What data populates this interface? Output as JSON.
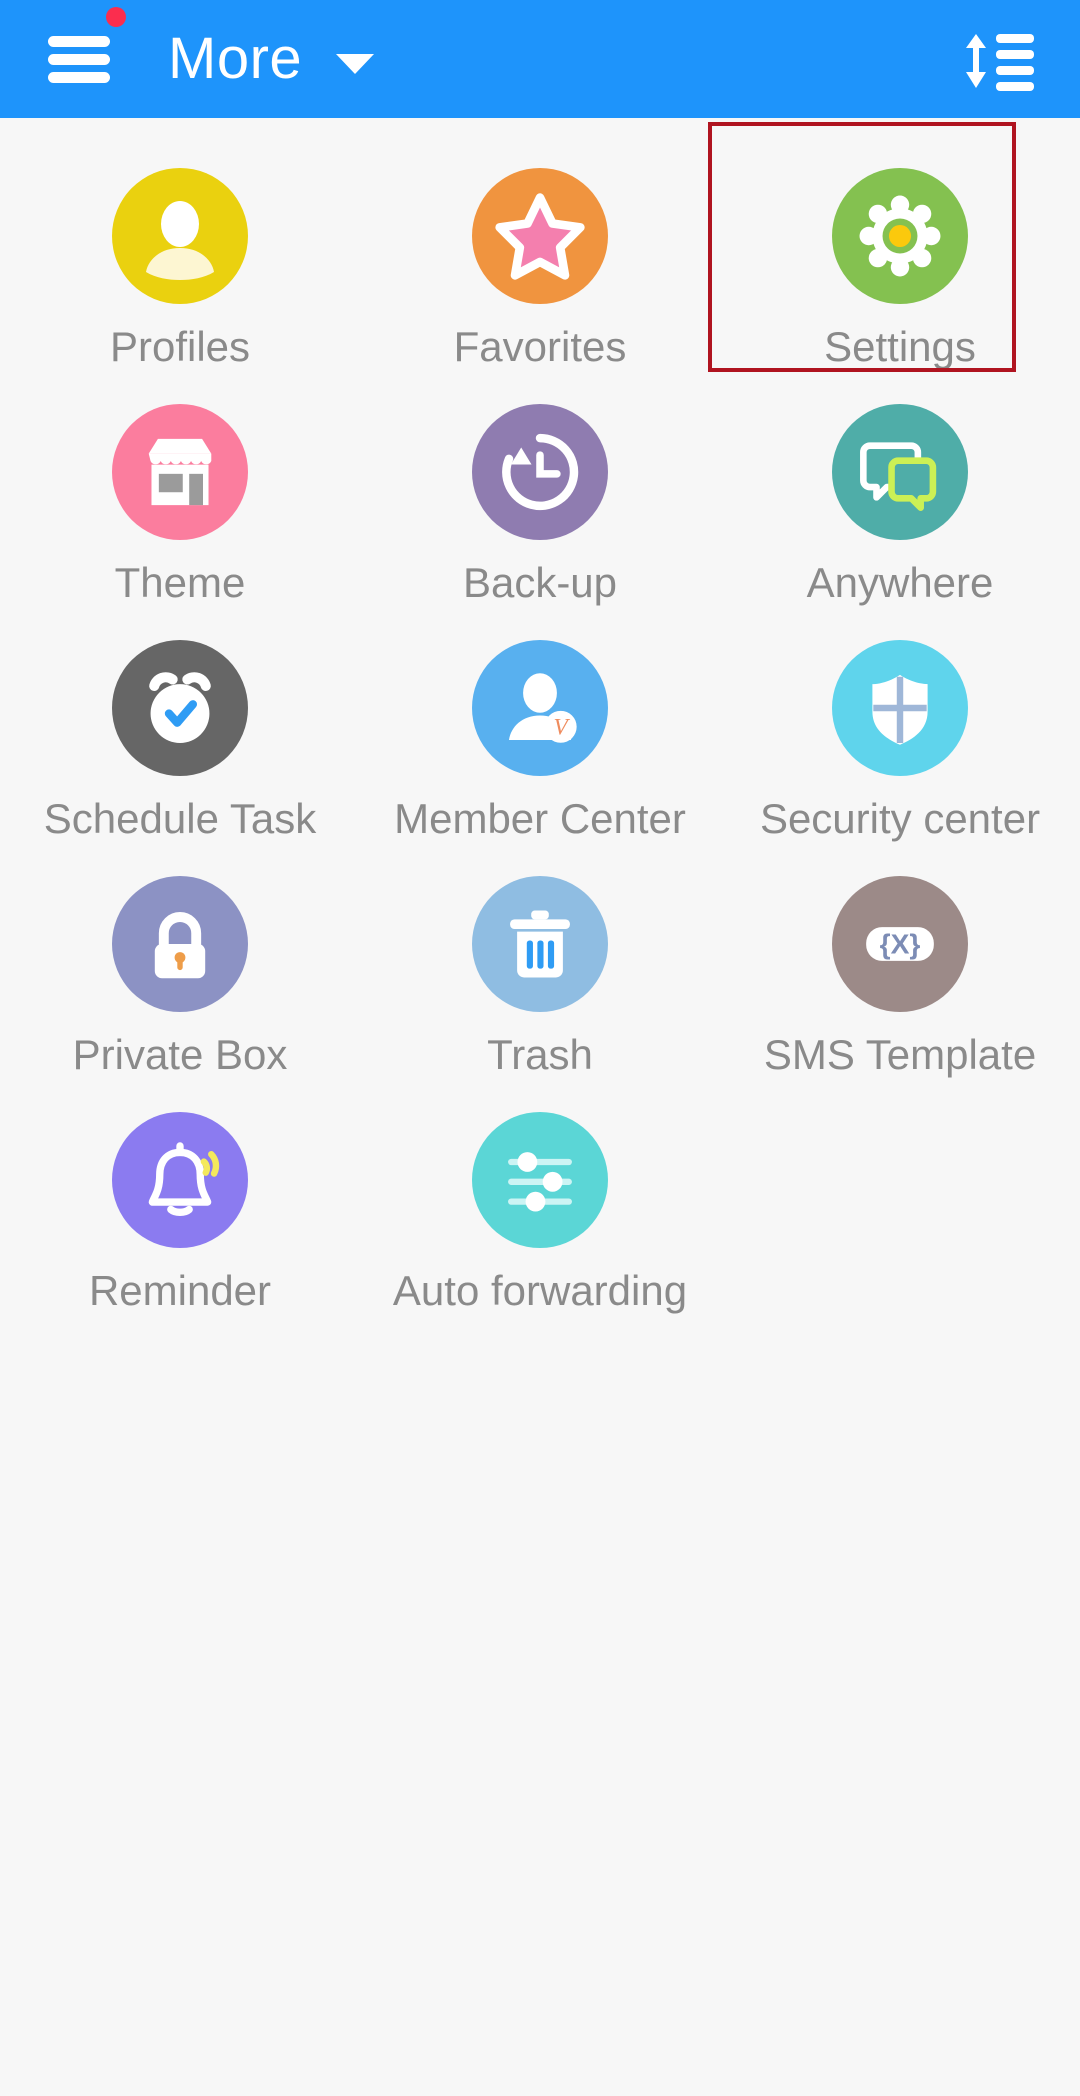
{
  "header": {
    "title": "More",
    "menu_icon": "hamburger-menu-icon",
    "badge": "notification-dot",
    "dropdown_icon": "chevron-down-icon",
    "sort_icon": "sort-list-icon",
    "background_color": "#1e94fb"
  },
  "highlight": {
    "target": "Settings",
    "color": "#b01420"
  },
  "grid": {
    "label_color": "#8a8a8a",
    "items": [
      {
        "label": "Profiles",
        "icon": "profile-person-icon",
        "circle_color": "#ead10f"
      },
      {
        "label": "Favorites",
        "icon": "star-icon",
        "circle_color": "#f0943f"
      },
      {
        "label": "Settings",
        "icon": "gear-icon",
        "circle_color": "#84c150"
      },
      {
        "label": "Theme",
        "icon": "storefront-icon",
        "circle_color": "#fb7d9e"
      },
      {
        "label": "Back-up",
        "icon": "clock-restore-icon",
        "circle_color": "#8f7cb0"
      },
      {
        "label": "Anywhere",
        "icon": "chat-bubbles-icon",
        "circle_color": "#4fada8"
      },
      {
        "label": "Schedule Task",
        "icon": "alarm-clock-check-icon",
        "circle_color": "#666666"
      },
      {
        "label": "Member Center",
        "icon": "member-vip-icon",
        "circle_color": "#58b0ef"
      },
      {
        "label": "Security center",
        "icon": "shield-icon",
        "circle_color": "#5fd4ec"
      },
      {
        "label": "Private Box",
        "icon": "padlock-icon",
        "circle_color": "#8c92c4"
      },
      {
        "label": "Trash",
        "icon": "trash-can-icon",
        "circle_color": "#8fbde2"
      },
      {
        "label": "SMS Template",
        "icon": "braces-x-icon",
        "circle_color": "#9c8a88"
      },
      {
        "label": "Reminder",
        "icon": "bell-ringing-icon",
        "circle_color": "#8b7bf0"
      },
      {
        "label": "Auto forwarding",
        "icon": "sliders-icon",
        "circle_color": "#5bd6d6"
      }
    ]
  }
}
